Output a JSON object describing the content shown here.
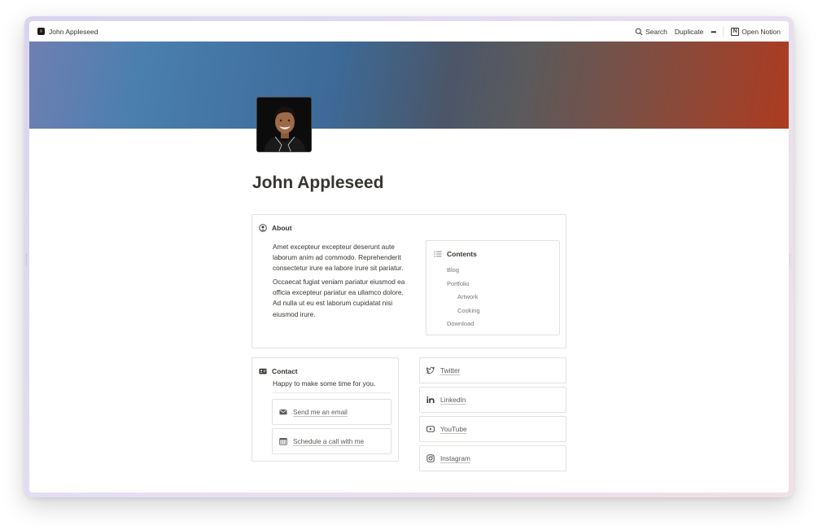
{
  "topbar": {
    "page_title": "John Appleseed",
    "search_label": "Search",
    "duplicate_label": "Duplicate",
    "more_label": "•••",
    "open_notion_label": "Open Notion"
  },
  "page": {
    "title": "John Appleseed"
  },
  "about": {
    "heading": "About",
    "paragraphs": [
      "Amet excepteur excepteur deserunt aute laborum anim ad commodo. Reprehenderit consectetur irure ea labore irure sit pariatur.",
      "Occaecat fugiat veniam pariatur eiusmod ea officia excepteur pariatur ea ullamco dolore. Ad nulla ut eu est laborum cupidatat nisi eiusmod irure."
    ]
  },
  "contents": {
    "heading": "Contents",
    "items": [
      "Blog",
      "Portfolio",
      "Artwork",
      "Cooking",
      "Download"
    ]
  },
  "contact": {
    "heading": "Contact",
    "subtitle": "Happy to make some time for you.",
    "email_label": "Send me an email",
    "schedule_label": "Schedule a call with me"
  },
  "social": {
    "twitter": "Twitter",
    "linkedin": "LinkedIn",
    "youtube": "YouTube",
    "instagram": "Instagram"
  },
  "colors": {
    "text": "#37352f",
    "muted": "#787774",
    "border": "#e3e2de",
    "cover_start": "#6f7fb2",
    "cover_end": "#ad3b21"
  }
}
